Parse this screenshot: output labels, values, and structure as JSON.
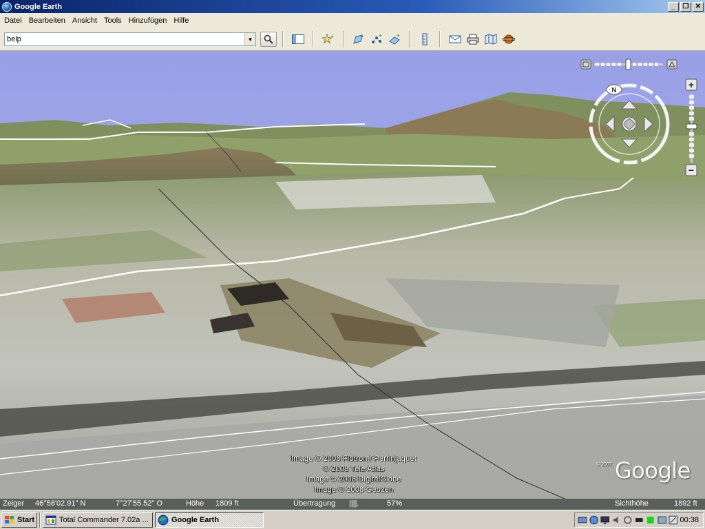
{
  "window": {
    "title": "Google Earth"
  },
  "menu": [
    "Datei",
    "Bearbeiten",
    "Ansicht",
    "Tools",
    "Hinzufügen",
    "Hilfe"
  ],
  "search": {
    "value": "belp"
  },
  "toolbar_icons": [
    "sidebar-toggle-icon",
    "placemark-icon",
    "polygon-icon",
    "path-icon",
    "image-overlay-icon",
    "ruler-icon",
    "email-icon",
    "print-icon",
    "maps-icon",
    "sky-icon"
  ],
  "attribution": [
    "Image © 2008 Flotron / Perrinjaquet",
    "© 2008 Tele Atlas",
    "Image © 2008 DigitalGlobe",
    "Image © 2008 Geozen"
  ],
  "logo": {
    "copyright": "© 2007",
    "text": "Google"
  },
  "status": {
    "pointer_label": "Zeiger",
    "lat": "46°58'02.91\" N",
    "lon": "7°27'55.52\" O",
    "elev_label": "Höhe",
    "elev_value": "1809 ft",
    "stream_label": "Übertragung",
    "stream_bars": "||||.",
    "stream_percent": "57%",
    "eye_label": "Sichthöhe",
    "eye_value": "1892 ft"
  },
  "compass": {
    "north": "N"
  },
  "taskbar": {
    "start": "Start",
    "tasks": [
      {
        "label": "Total Commander 7.02a ...",
        "active": false
      },
      {
        "label": "Google Earth",
        "active": true
      }
    ],
    "clock": "00:38"
  },
  "colors": {
    "sky": "#9aa0e6",
    "title_start": "#0a246a",
    "statusbar": "#5b5f5b"
  }
}
